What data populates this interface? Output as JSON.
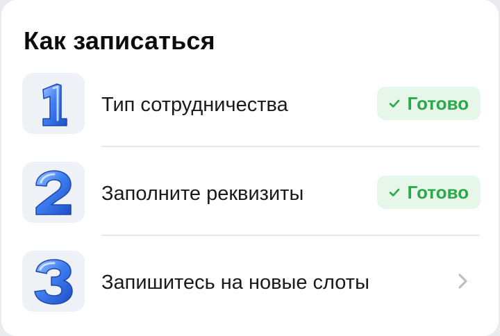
{
  "title": "Как записаться",
  "steps": [
    {
      "number": "1",
      "label": "Тип сотрудничества",
      "status": "Готово",
      "done": true
    },
    {
      "number": "2",
      "label": "Заполните реквизиты",
      "status": "Готово",
      "done": true
    },
    {
      "number": "3",
      "label": "Запишитесь на новые слоты",
      "done": false
    }
  ],
  "icons": {
    "step_1": "balloon-digit-one-icon",
    "step_2": "balloon-digit-two-icon",
    "step_3": "balloon-digit-three-icon",
    "check": "check-icon",
    "chevron": "chevron-right-icon"
  },
  "colors": {
    "status_text": "#2aa84a",
    "status_bg": "#e6f7ea",
    "digit_blue": "#2f6de0",
    "icon_bg": "#eef1f6",
    "chevron": "#b9bec7"
  }
}
